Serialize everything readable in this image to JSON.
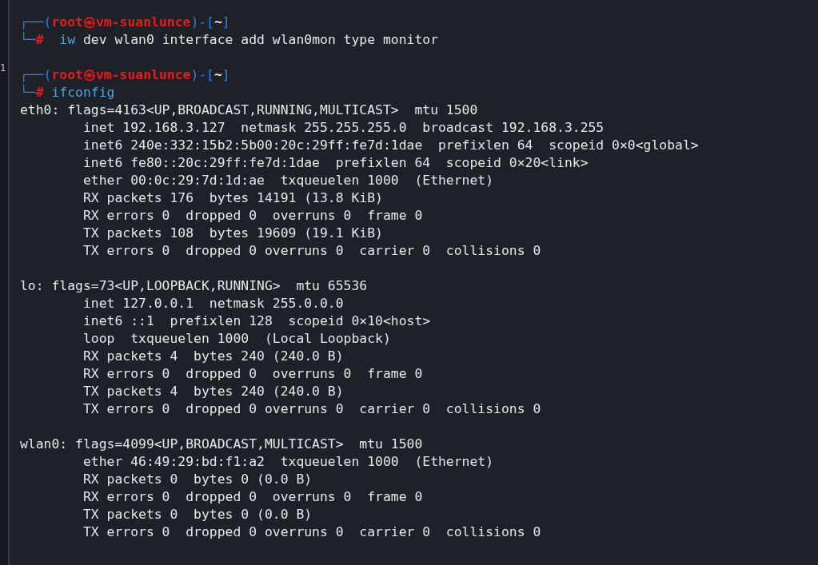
{
  "gutter": {
    "text": "1"
  },
  "terminal": {
    "lines": [
      {
        "kind": "prompt",
        "segments": [
          {
            "kind": "frame",
            "text": "┌──("
          },
          {
            "kind": "user",
            "text": "root㉿vm-suanlunce"
          },
          {
            "kind": "frame",
            "text": ")-["
          },
          {
            "kind": "path",
            "text": "~"
          },
          {
            "kind": "frame",
            "text": "]"
          }
        ]
      },
      {
        "kind": "prompt",
        "segments": [
          {
            "kind": "frame",
            "text": "└─"
          },
          {
            "kind": "hash",
            "text": "#"
          },
          {
            "kind": "cmd",
            "text": "  iw"
          },
          {
            "kind": "arg",
            "text": " dev wlan0 interface add wlan0mon type monitor"
          }
        ]
      },
      {
        "kind": "blank"
      },
      {
        "kind": "prompt",
        "segments": [
          {
            "kind": "frame",
            "text": "┌──("
          },
          {
            "kind": "user",
            "text": "root㉿vm-suanlunce"
          },
          {
            "kind": "frame",
            "text": ")-["
          },
          {
            "kind": "path",
            "text": "~"
          },
          {
            "kind": "frame",
            "text": "]"
          }
        ]
      },
      {
        "kind": "prompt",
        "segments": [
          {
            "kind": "frame",
            "text": "└─"
          },
          {
            "kind": "hash",
            "text": "#"
          },
          {
            "kind": "cmd",
            "text": " ifconfig"
          }
        ]
      },
      {
        "kind": "output",
        "text": "eth0: flags=4163<UP,BROADCAST,RUNNING,MULTICAST>  mtu 1500"
      },
      {
        "kind": "output",
        "text": "        inet 192.168.3.127  netmask 255.255.255.0  broadcast 192.168.3.255"
      },
      {
        "kind": "output",
        "text": "        inet6 240e:332:15b2:5b00:20c:29ff:fe7d:1dae  prefixlen 64  scopeid 0×0<global>"
      },
      {
        "kind": "output",
        "text": "        inet6 fe80::20c:29ff:fe7d:1dae  prefixlen 64  scopeid 0×20<link>"
      },
      {
        "kind": "output",
        "text": "        ether 00:0c:29:7d:1d:ae  txqueuelen 1000  (Ethernet)"
      },
      {
        "kind": "output",
        "text": "        RX packets 176  bytes 14191 (13.8 KiB)"
      },
      {
        "kind": "output",
        "text": "        RX errors 0  dropped 0  overruns 0  frame 0"
      },
      {
        "kind": "output",
        "text": "        TX packets 108  bytes 19609 (19.1 KiB)"
      },
      {
        "kind": "output",
        "text": "        TX errors 0  dropped 0 overruns 0  carrier 0  collisions 0"
      },
      {
        "kind": "blank"
      },
      {
        "kind": "output",
        "text": "lo: flags=73<UP,LOOPBACK,RUNNING>  mtu 65536"
      },
      {
        "kind": "output",
        "text": "        inet 127.0.0.1  netmask 255.0.0.0"
      },
      {
        "kind": "output",
        "text": "        inet6 ::1  prefixlen 128  scopeid 0×10<host>"
      },
      {
        "kind": "output",
        "text": "        loop  txqueuelen 1000  (Local Loopback)"
      },
      {
        "kind": "output",
        "text": "        RX packets 4  bytes 240 (240.0 B)"
      },
      {
        "kind": "output",
        "text": "        RX errors 0  dropped 0  overruns 0  frame 0"
      },
      {
        "kind": "output",
        "text": "        TX packets 4  bytes 240 (240.0 B)"
      },
      {
        "kind": "output",
        "text": "        TX errors 0  dropped 0 overruns 0  carrier 0  collisions 0"
      },
      {
        "kind": "blank"
      },
      {
        "kind": "output",
        "text": "wlan0: flags=4099<UP,BROADCAST,MULTICAST>  mtu 1500"
      },
      {
        "kind": "output",
        "text": "        ether 46:49:29:bd:f1:a2  txqueuelen 1000  (Ethernet)"
      },
      {
        "kind": "output",
        "text": "        RX packets 0  bytes 0 (0.0 B)"
      },
      {
        "kind": "output",
        "text": "        RX errors 0  dropped 0  overruns 0  frame 0"
      },
      {
        "kind": "output",
        "text": "        TX packets 0  bytes 0 (0.0 B)"
      },
      {
        "kind": "output",
        "text": "        TX errors 0  dropped 0 overruns 0  carrier 0  collisions 0"
      }
    ]
  }
}
